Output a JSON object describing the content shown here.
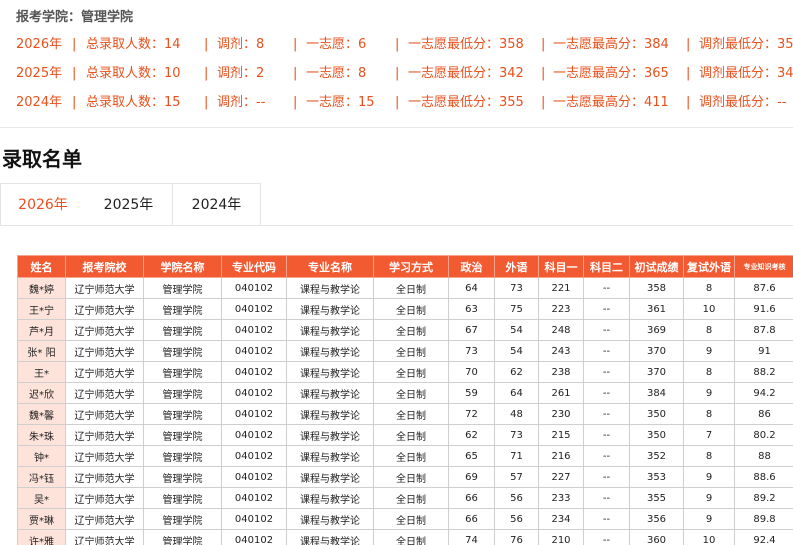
{
  "header": {
    "college_label": "报考学院：管理学院"
  },
  "stats": [
    {
      "year": "2026年",
      "total": "总录取人数：14",
      "adjust": "调剂：8",
      "first_choice": "一志愿：6",
      "first_min": "一志愿最低分：358",
      "first_max": "一志愿最高分：384",
      "adjust_min": "调剂最低分：35"
    },
    {
      "year": "2025年",
      "total": "总录取人数：10",
      "adjust": "调剂：2",
      "first_choice": "一志愿：8",
      "first_min": "一志愿最低分：342",
      "first_max": "一志愿最高分：365",
      "adjust_min": "调剂最低分：34"
    },
    {
      "year": "2024年",
      "total": "总录取人数：15",
      "adjust": "调剂：--",
      "first_choice": "一志愿：15",
      "first_min": "一志愿最低分：355",
      "first_max": "一志愿最高分：411",
      "adjust_min": "调剂最低分：--"
    }
  ],
  "separator": "|",
  "section": {
    "title": "录取名单"
  },
  "tabs": [
    {
      "label": "2026年",
      "active": true
    },
    {
      "label": "2025年",
      "active": false
    },
    {
      "label": "2024年",
      "active": false
    }
  ],
  "table": {
    "columns": [
      "姓名",
      "报考院校",
      "学院名称",
      "专业代码",
      "专业名称",
      "学习方式",
      "政治",
      "外语",
      "科目一",
      "科目二",
      "初试成绩",
      "复试外语",
      "专业知识考核"
    ],
    "rows": [
      [
        "魏*婷",
        "辽宁师范大学",
        "管理学院",
        "040102",
        "课程与教学论",
        "全日制",
        "64",
        "73",
        "221",
        "--",
        "358",
        "8",
        "87.6"
      ],
      [
        "王*宁",
        "辽宁师范大学",
        "管理学院",
        "040102",
        "课程与教学论",
        "全日制",
        "63",
        "75",
        "223",
        "--",
        "361",
        "10",
        "91.6"
      ],
      [
        "芦*月",
        "辽宁师范大学",
        "管理学院",
        "040102",
        "课程与教学论",
        "全日制",
        "67",
        "54",
        "248",
        "--",
        "369",
        "8",
        "87.8"
      ],
      [
        "张* 阳",
        "辽宁师范大学",
        "管理学院",
        "040102",
        "课程与教学论",
        "全日制",
        "73",
        "54",
        "243",
        "--",
        "370",
        "9",
        "91"
      ],
      [
        "王*",
        "辽宁师范大学",
        "管理学院",
        "040102",
        "课程与教学论",
        "全日制",
        "70",
        "62",
        "238",
        "--",
        "370",
        "8",
        "88.2"
      ],
      [
        "迟*欣",
        "辽宁师范大学",
        "管理学院",
        "040102",
        "课程与教学论",
        "全日制",
        "59",
        "64",
        "261",
        "--",
        "384",
        "9",
        "94.2"
      ],
      [
        "魏*馨",
        "辽宁师范大学",
        "管理学院",
        "040102",
        "课程与教学论",
        "全日制",
        "72",
        "48",
        "230",
        "--",
        "350",
        "8",
        "86"
      ],
      [
        "朱*珠",
        "辽宁师范大学",
        "管理学院",
        "040102",
        "课程与教学论",
        "全日制",
        "62",
        "73",
        "215",
        "--",
        "350",
        "7",
        "80.2"
      ],
      [
        "钟*",
        "辽宁师范大学",
        "管理学院",
        "040102",
        "课程与教学论",
        "全日制",
        "65",
        "71",
        "216",
        "--",
        "352",
        "8",
        "88"
      ],
      [
        "冯*钰",
        "辽宁师范大学",
        "管理学院",
        "040102",
        "课程与教学论",
        "全日制",
        "69",
        "57",
        "227",
        "--",
        "353",
        "9",
        "88.6"
      ],
      [
        "吴*",
        "辽宁师范大学",
        "管理学院",
        "040102",
        "课程与教学论",
        "全日制",
        "66",
        "56",
        "233",
        "--",
        "355",
        "9",
        "89.2"
      ],
      [
        "贾*琳",
        "辽宁师范大学",
        "管理学院",
        "040102",
        "课程与教学论",
        "全日制",
        "66",
        "56",
        "234",
        "--",
        "356",
        "9",
        "89.8"
      ],
      [
        "许*雅",
        "辽宁师范大学",
        "管理学院",
        "040102",
        "课程与教学论",
        "全日制",
        "74",
        "76",
        "210",
        "--",
        "360",
        "10",
        "92.4"
      ]
    ]
  },
  "colors": {
    "accent": "#e8511d",
    "header_bg": "#f25a32",
    "name_bg": "#fde3da"
  }
}
